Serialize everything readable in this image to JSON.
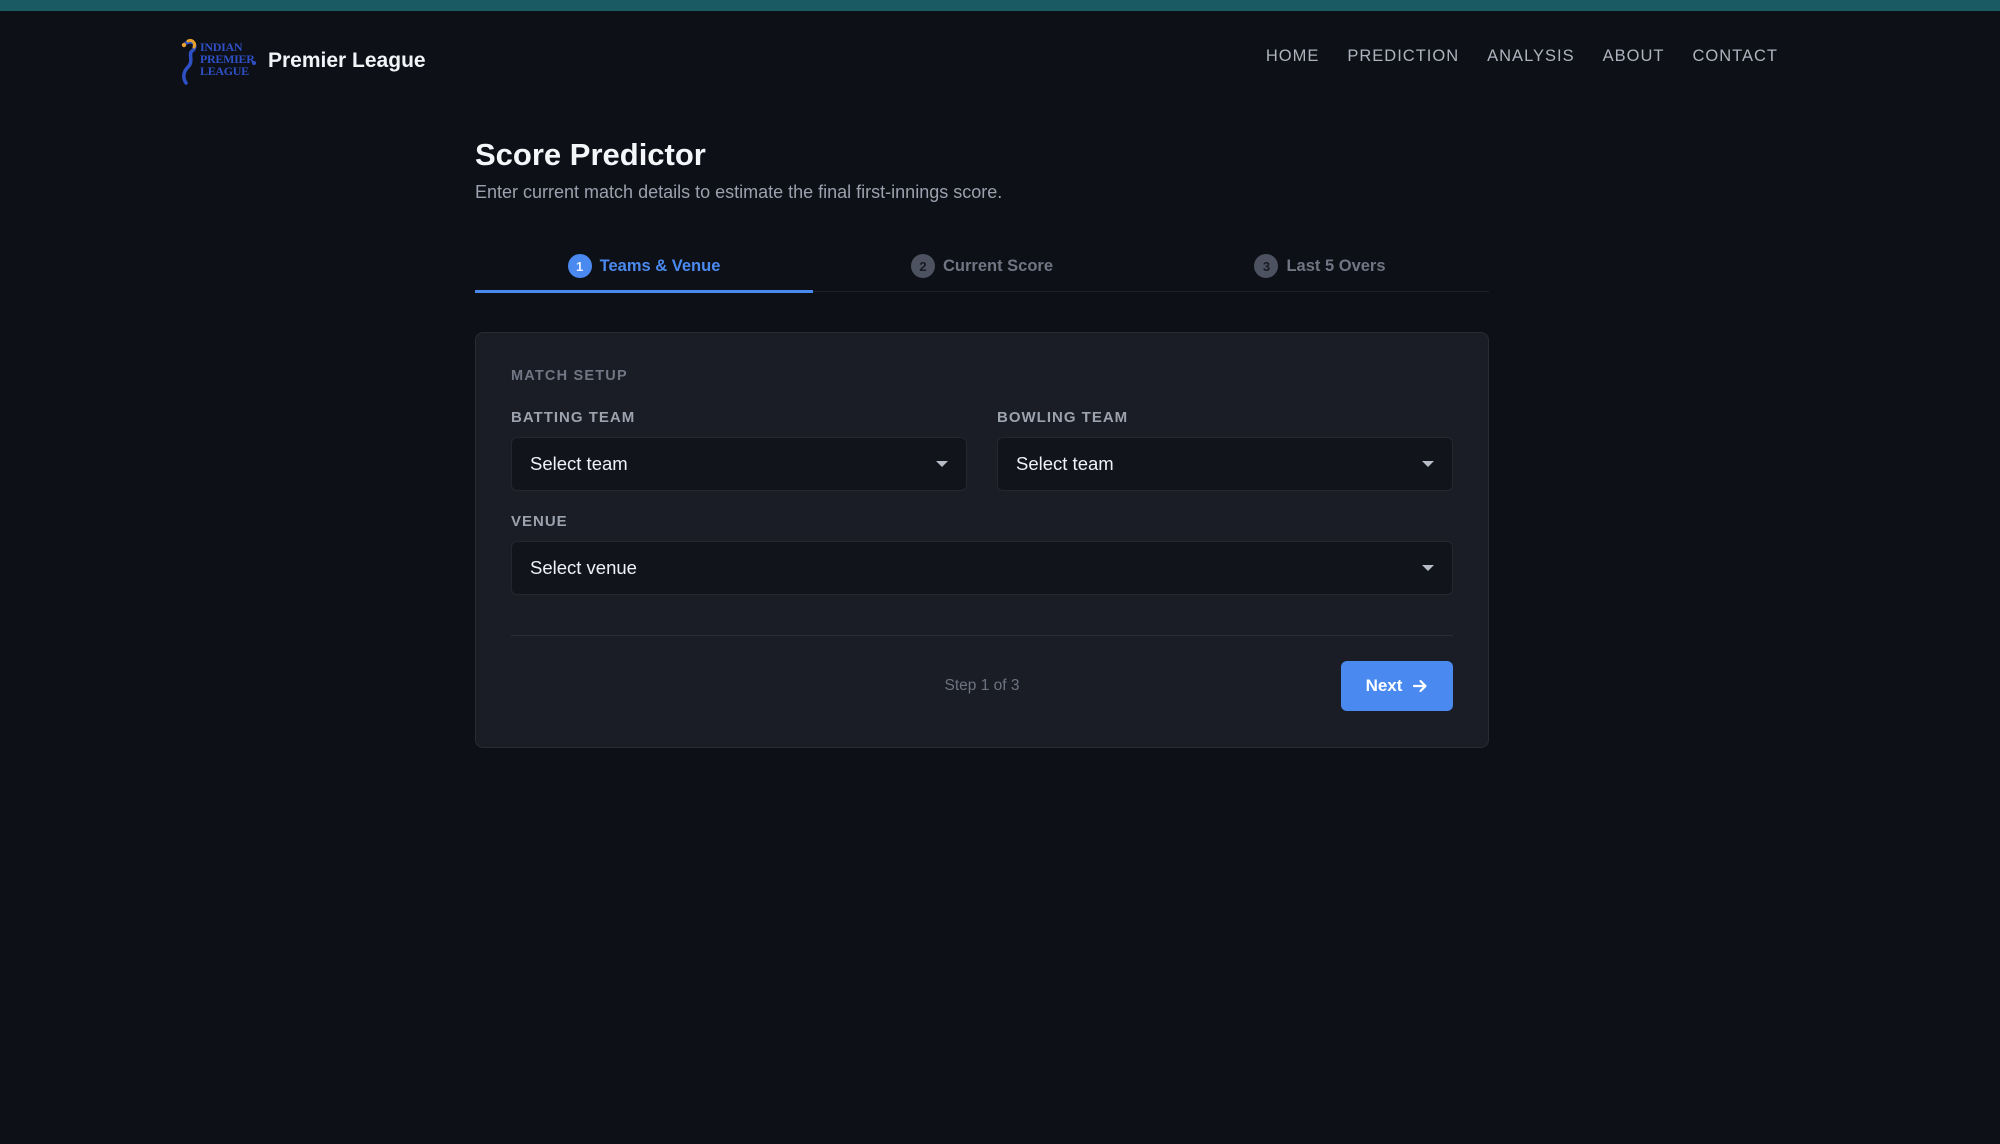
{
  "brand": {
    "logo_lines": [
      "INDIAN",
      "PREMIER",
      "LEAGUE"
    ],
    "name": "Premier League"
  },
  "nav": {
    "items": [
      "HOME",
      "PREDICTION",
      "ANALYSIS",
      "ABOUT",
      "CONTACT"
    ]
  },
  "page": {
    "title": "Score Predictor",
    "subtitle": "Enter current match details to estimate the final first-innings score."
  },
  "tabs": [
    {
      "number": "1",
      "label": "Teams & Venue",
      "active": true
    },
    {
      "number": "2",
      "label": "Current Score",
      "active": false
    },
    {
      "number": "3",
      "label": "Last 5 Overs",
      "active": false
    }
  ],
  "form": {
    "section_label": "MATCH SETUP",
    "batting_team": {
      "label": "BATTING TEAM",
      "value": "Select team"
    },
    "bowling_team": {
      "label": "BOWLING TEAM",
      "value": "Select team"
    },
    "venue": {
      "label": "VENUE",
      "value": "Select venue"
    }
  },
  "footer": {
    "step_text": "Step 1 of 3",
    "next_label": "Next"
  },
  "colors": {
    "accent": "#4a8af0",
    "background": "#0d1016",
    "card": "#1a1d25",
    "topbar": "#1a5a63"
  },
  "icons": {
    "logo": "ipl-batsman-logo",
    "select_caret": "caret-down-icon",
    "next_arrow": "arrow-right-icon"
  }
}
